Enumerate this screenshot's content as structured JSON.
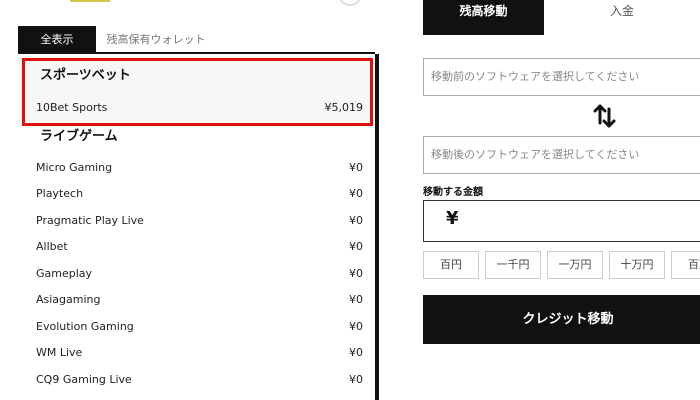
{
  "left": {
    "tabs": [
      {
        "label": "全表示",
        "active": true
      },
      {
        "label": "残高保有ウォレット",
        "active": false
      }
    ],
    "sections": [
      {
        "title": "スポーツベット",
        "rows": [
          {
            "name": "10Bet Sports",
            "value": "¥5,019"
          }
        ]
      },
      {
        "title": "ライブゲーム",
        "rows": [
          {
            "name": "Micro Gaming",
            "value": "¥0"
          },
          {
            "name": "Playtech",
            "value": "¥0"
          },
          {
            "name": "Pragmatic Play Live",
            "value": "¥0"
          },
          {
            "name": "Allbet",
            "value": "¥0"
          },
          {
            "name": "Gameplay",
            "value": "¥0"
          },
          {
            "name": "Asiagaming",
            "value": "¥0"
          },
          {
            "name": "Evolution Gaming",
            "value": "¥0"
          },
          {
            "name": "WM Live",
            "value": "¥0"
          },
          {
            "name": "CQ9 Gaming Live",
            "value": "¥0"
          }
        ]
      }
    ]
  },
  "right": {
    "tabs": [
      {
        "label": "残高移動",
        "active": true
      },
      {
        "label": "入金",
        "active": false
      }
    ],
    "from_select_placeholder": "移動前のソフトウェアを選択してください",
    "to_select_placeholder": "移動後のソフトウェアを選択してください",
    "amount_label": "移動する金額",
    "currency_symbol": "¥",
    "quick_amounts": [
      "百円",
      "一千円",
      "一万円",
      "十万円",
      "百万"
    ],
    "submit_label": "クレジット移動"
  },
  "colors": {
    "highlight": "#e01010",
    "dark": "#111111",
    "section_bg": "#f7f7f7"
  }
}
